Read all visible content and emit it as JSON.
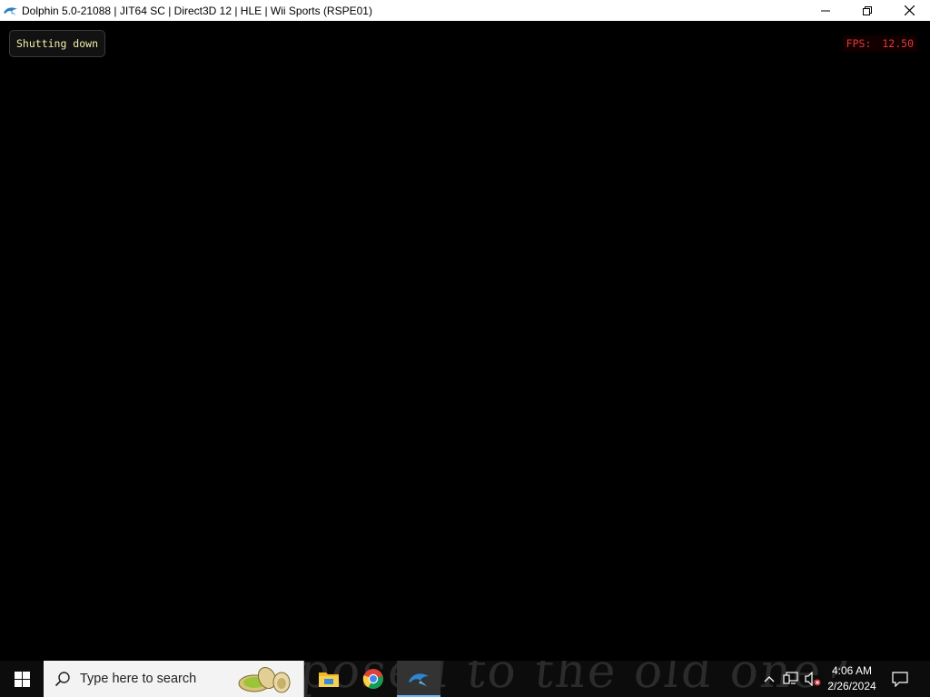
{
  "window": {
    "title": "Dolphin 5.0-21088 | JIT64 SC | Direct3D 12 | HLE | Wii Sports (RSPE01)",
    "icon": "dolphin-icon",
    "controls": [
      "minimize-icon",
      "restore-icon",
      "close-icon"
    ]
  },
  "game": {
    "osd_message": "Shutting down",
    "fps_label": "FPS:",
    "fps_value": "12.50",
    "osd_color": "#f2f0a8",
    "fps_color": "#e23a3a"
  },
  "taskbar": {
    "wallpaper_text": "posed to the old one?",
    "start_icon": "windows-logo-icon",
    "search_placeholder": "Type here to search",
    "search_highlight": "pistachio-illustration",
    "apps": [
      {
        "name": "File Explorer",
        "icon": "file-explorer-icon",
        "active": false
      },
      {
        "name": "Google Chrome",
        "icon": "chrome-icon",
        "active": false
      },
      {
        "name": "Dolphin",
        "icon": "dolphin-icon",
        "active": true
      }
    ],
    "tray": {
      "icons": [
        "chevron-up-icon",
        "network-icon",
        "volume-muted-icon"
      ],
      "time": "4:06 AM",
      "date": "2/26/2024",
      "notification_icon": "notification-icon"
    },
    "accent_color": "#6ab7ff"
  }
}
